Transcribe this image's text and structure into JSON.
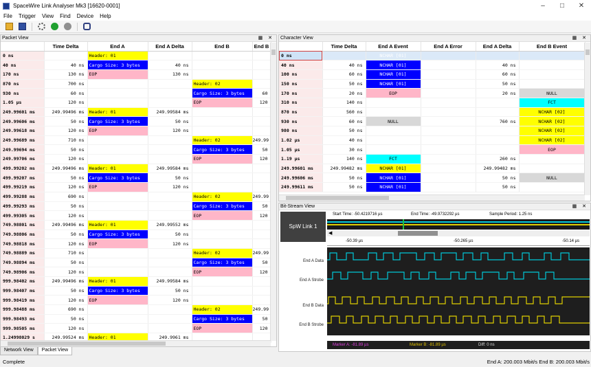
{
  "window": {
    "title": "SpaceWire Link Analyser Mk3 [16620-0001]"
  },
  "menu": [
    "File",
    "Trigger",
    "View",
    "Find",
    "Device",
    "Help"
  ],
  "packet_view": {
    "title": "Packet View",
    "columns": [
      "",
      "Time Delta",
      "End A",
      "End A Delta",
      "End B",
      "End B"
    ],
    "rows": [
      [
        "0 ns",
        "",
        "Header: 01",
        "",
        "",
        ""
      ],
      [
        "40 ns",
        "40 ns",
        "Cargo Size: 3 bytes",
        "40 ns",
        "",
        ""
      ],
      [
        "170 ns",
        "130 ns",
        "EOP",
        "130 ns",
        "",
        ""
      ],
      [
        "870 ns",
        "700 ns",
        "",
        "",
        "Header: 02",
        ""
      ],
      [
        "930 ns",
        "60 ns",
        "",
        "",
        "Cargo Size: 3 bytes",
        "60"
      ],
      [
        "1.05 µs",
        "120 ns",
        "",
        "",
        "EOP",
        "120"
      ],
      [
        "249.99601 ms",
        "249.99496 ms",
        "Header: 01",
        "249.99584 ms",
        "",
        ""
      ],
      [
        "249.99606 ms",
        "50 ns",
        "Cargo Size: 3 bytes",
        "50 ns",
        "",
        ""
      ],
      [
        "249.99618 ms",
        "120 ns",
        "EOP",
        "120 ns",
        "",
        ""
      ],
      [
        "249.99689 ms",
        "710 ns",
        "",
        "",
        "Header: 02",
        "249.99"
      ],
      [
        "249.99694 ms",
        "50 ns",
        "",
        "",
        "Cargo Size: 3 bytes",
        "50"
      ],
      [
        "249.99706 ms",
        "120 ns",
        "",
        "",
        "EOP",
        "120"
      ],
      [
        "499.99202 ms",
        "249.99496 ms",
        "Header: 01",
        "249.99584 ms",
        "",
        ""
      ],
      [
        "499.99207 ms",
        "50 ns",
        "Cargo Size: 3 bytes",
        "50 ns",
        "",
        ""
      ],
      [
        "499.99219 ms",
        "120 ns",
        "EOP",
        "120 ns",
        "",
        ""
      ],
      [
        "499.99288 ms",
        "690 ns",
        "",
        "",
        "Header: 02",
        "249.99"
      ],
      [
        "499.99293 ms",
        "50 ns",
        "",
        "",
        "Cargo Size: 3 bytes",
        "50"
      ],
      [
        "499.99305 ms",
        "120 ns",
        "",
        "",
        "EOP",
        "120"
      ],
      [
        "749.98801 ms",
        "249.99496 ms",
        "Header: 01",
        "249.99552 ms",
        "",
        ""
      ],
      [
        "749.98806 ms",
        "50 ns",
        "Cargo Size: 3 bytes",
        "50 ns",
        "",
        ""
      ],
      [
        "749.98818 ms",
        "120 ns",
        "EOP",
        "120 ns",
        "",
        ""
      ],
      [
        "749.98889 ms",
        "710 ns",
        "",
        "",
        "Header: 02",
        "249.99"
      ],
      [
        "749.98894 ms",
        "50 ns",
        "",
        "",
        "Cargo Size: 3 bytes",
        "50"
      ],
      [
        "749.98906 ms",
        "120 ns",
        "",
        "",
        "EOP",
        "120"
      ],
      [
        "999.98402 ms",
        "249.99496 ms",
        "Header: 01",
        "249.99584 ms",
        "",
        ""
      ],
      [
        "999.98407 ms",
        "50 ns",
        "Cargo Size: 3 bytes",
        "50 ns",
        "",
        ""
      ],
      [
        "999.98419 ms",
        "120 ns",
        "EOP",
        "120 ns",
        "",
        ""
      ],
      [
        "999.98488 ms",
        "690 ns",
        "",
        "",
        "Header: 02",
        "249.99"
      ],
      [
        "999.98493 ms",
        "50 ns",
        "",
        "",
        "Cargo Size: 3 bytes",
        "50"
      ],
      [
        "999.98505 ms",
        "120 ns",
        "",
        "",
        "EOP",
        "120"
      ],
      [
        "1.24998029 s",
        "249.99524 ms",
        "Header: 01",
        "249.9961 ms",
        "",
        ""
      ]
    ]
  },
  "character_view": {
    "title": "Character View",
    "columns": [
      "",
      "Time Delta",
      "End A Event",
      "End A Error",
      "End A Delta",
      "End B Event"
    ],
    "rows": [
      [
        "0 ns",
        "",
        "NCHAR [01]",
        "",
        "",
        ""
      ],
      [
        "40 ns",
        "40 ns",
        "NCHAR [01]",
        "",
        "40 ns",
        ""
      ],
      [
        "100 ns",
        "60 ns",
        "NCHAR [01]",
        "",
        "60 ns",
        ""
      ],
      [
        "150 ns",
        "50 ns",
        "NCHAR [01]",
        "",
        "50 ns",
        ""
      ],
      [
        "170 ns",
        "20 ns",
        "EOP",
        "",
        "20 ns",
        "NULL"
      ],
      [
        "310 ns",
        "140 ns",
        "",
        "",
        "",
        "FCT"
      ],
      [
        "870 ns",
        "560 ns",
        "",
        "",
        "",
        "NCHAR [02]"
      ],
      [
        "930 ns",
        "60 ns",
        "NULL",
        "",
        "760 ns",
        "NCHAR [02]"
      ],
      [
        "980 ns",
        "50 ns",
        "",
        "",
        "",
        "NCHAR [02]"
      ],
      [
        "1.02 µs",
        "40 ns",
        "",
        "",
        "",
        "NCHAR [02]"
      ],
      [
        "1.05 µs",
        "30 ns",
        "",
        "",
        "",
        "EOP"
      ],
      [
        "1.19 µs",
        "140 ns",
        "FCT",
        "",
        "260 ns",
        ""
      ],
      [
        "249.99601 ms",
        "249.99482 ms",
        "NCHAR [01]",
        "",
        "249.99482 ms",
        ""
      ],
      [
        "249.99606 ms",
        "50 ns",
        "NCHAR [01]",
        "",
        "50 ns",
        "NULL"
      ],
      [
        "249.99611 ms",
        "50 ns",
        "NCHAR [01]",
        "",
        "50 ns",
        ""
      ]
    ]
  },
  "bitstream": {
    "title": "Bit-Stream View",
    "link": "SpW Link 1",
    "start_time": "Start Time: -50.4219716 µs",
    "end_time": "End Time: -49.9732292 µs",
    "sample_period": "Sample Period: 1.25 ns",
    "ticks": [
      "-50.39 µs",
      "-50.265 µs",
      "-50.14 µs"
    ],
    "signals": [
      "End A Data",
      "End A Strobe",
      "End B Data",
      "End B Strobe"
    ],
    "marker_a": "Marker A: -81.89 µs",
    "marker_b": "Marker B: -81.89 µs",
    "diff": "Diff: 0 ns",
    "colors": {
      "end_a": "#00c8d8",
      "end_b": "#e0d000",
      "marker_a": "#e040e0",
      "marker_b": "#e0c000"
    }
  },
  "tabs": [
    "Network View",
    "Packet View"
  ],
  "status": {
    "left": "Complete",
    "right": "End A: 200.003 Mbit/s  End B: 200.003 Mbit/s"
  }
}
